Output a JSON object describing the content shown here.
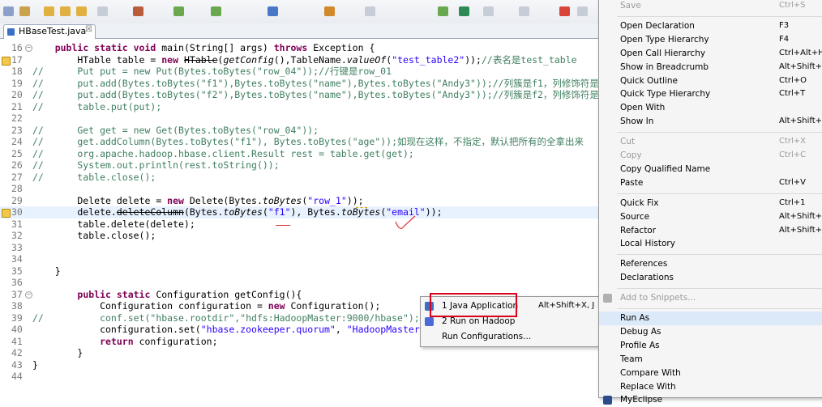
{
  "editor_tab": {
    "label": "HBaseTest.java",
    "close": "☒"
  },
  "code_lines": [
    {
      "n": "16",
      "html": "    <span class='kw'>public static void</span> main(String[] args) <span class='kw'>throws</span> Exception {"
    },
    {
      "n": "17",
      "html": "        HTable table = <span class='kw'>new</span> <span class='strike'>HTable</span>(<span class='ital'>getConfig</span>(),TableName.<span class='ital'>valueOf</span>(<span class='str'>\"test_table2\"</span>));<span class='com'>//表名是test_table</span>"
    },
    {
      "n": "18",
      "html": "<span class='com'>//      Put put = new Put(Bytes.toBytes(\"row_04\"));//行键是row_01</span>"
    },
    {
      "n": "19",
      "html": "<span class='com'>//      put.add(Bytes.toBytes(\"f1\"),Bytes.toBytes(\"name\"),Bytes.toBytes(\"Andy3\"));//列簇是f1，列修饰符是nam</span>"
    },
    {
      "n": "20",
      "html": "<span class='com'>//      put.add(Bytes.toBytes(\"f2\"),Bytes.toBytes(\"name\"),Bytes.toBytes(\"Andy3\"));//列簇是f2，列修饰符是nam</span>"
    },
    {
      "n": "21",
      "html": "<span class='com'>//      table.put(put);</span>"
    },
    {
      "n": "22",
      "html": ""
    },
    {
      "n": "23",
      "html": "<span class='com'>//      Get get = new Get(Bytes.toBytes(\"row_04\"));</span>"
    },
    {
      "n": "24",
      "html": "<span class='com'>//      get.addColumn(Bytes.toBytes(\"f1\"), Bytes.toBytes(\"age\"));如现在这样，不指定，默认把所有的全拿出来</span>"
    },
    {
      "n": "25",
      "html": "<span class='com'>//      org.apache.hadoop.hbase.client.Result rest = table.get(get);</span>"
    },
    {
      "n": "26",
      "html": "<span class='com'>//      System.out.println(rest.toString());</span>"
    },
    {
      "n": "27",
      "html": "<span class='com'>//      table.close();</span>"
    },
    {
      "n": "28",
      "html": ""
    },
    {
      "n": "29",
      "html": "        Delete delete = <span class='kw'>new</span> Delete(Bytes.<span class='ital'>toBytes</span>(<span class='str'>\"row_1\"</span>));"
    },
    {
      "n": "30",
      "html": "        delete.<span class='strike'>deleteColumn</span>(Bytes.<span class='ital'>toBytes</span>(<span class='str'>\"f1\"</span>), Bytes.<span class='ital'>toBytes</span>(<span class='str'>\"email\"</span>));"
    },
    {
      "n": "31",
      "html": "        table.delete(delete);"
    },
    {
      "n": "32",
      "html": "        table.close();"
    },
    {
      "n": "33",
      "html": ""
    },
    {
      "n": "34",
      "html": ""
    },
    {
      "n": "35",
      "html": "    }"
    },
    {
      "n": "36",
      "html": ""
    },
    {
      "n": "37",
      "html": "        <span class='kw'>public static</span> Configuration getConfig(){"
    },
    {
      "n": "38",
      "html": "            Configuration configuration = <span class='kw'>new</span> Configuration();"
    },
    {
      "n": "39",
      "html": "<span class='com'>//          conf.set(\"hbase.rootdir\",\"hdfs:HadoopMaster:9000/hbase\");</span>"
    },
    {
      "n": "40",
      "html": "            configuration.set(<span class='str'>\"hbase.zookeeper.quorum\"</span>, <span class='str'>\"HadoopMaster</span>"
    },
    {
      "n": "41",
      "html": "            <span class='kw'>return</span> configuration;"
    },
    {
      "n": "42",
      "html": "        }"
    },
    {
      "n": "43",
      "html": "}"
    },
    {
      "n": "44",
      "html": ""
    }
  ],
  "run_as_submenu": {
    "items": [
      {
        "label": "1 Java Application",
        "accel": "Alt+Shift+X, J",
        "icon_color": "#3a6fc7"
      },
      {
        "label": "2 Run on Hadoop",
        "accel": "",
        "icon_color": "#4a6bd8"
      },
      {
        "label": "Run Configurations...",
        "accel": "",
        "icon_color": ""
      }
    ]
  },
  "context_menu": {
    "items": [
      {
        "label": "Save",
        "accel": "Ctrl+S",
        "disabled": true
      },
      {
        "sep": true
      },
      {
        "label": "Open Declaration",
        "accel": "F3"
      },
      {
        "label": "Open Type Hierarchy",
        "accel": "F4"
      },
      {
        "label": "Open Call Hierarchy",
        "accel": "Ctrl+Alt+H"
      },
      {
        "label": "Show in Breadcrumb",
        "accel": "Alt+Shift+B"
      },
      {
        "label": "Quick Outline",
        "accel": "Ctrl+O"
      },
      {
        "label": "Quick Type Hierarchy",
        "accel": "Ctrl+T"
      },
      {
        "label": "Open With",
        "accel": ""
      },
      {
        "label": "Show In",
        "accel": "Alt+Shift+W"
      },
      {
        "sep": true
      },
      {
        "label": "Cut",
        "accel": "Ctrl+X",
        "disabled": true
      },
      {
        "label": "Copy",
        "accel": "Ctrl+C",
        "disabled": true
      },
      {
        "label": "Copy Qualified Name",
        "accel": ""
      },
      {
        "label": "Paste",
        "accel": "Ctrl+V"
      },
      {
        "sep": true
      },
      {
        "label": "Quick Fix",
        "accel": "Ctrl+1"
      },
      {
        "label": "Source",
        "accel": "Alt+Shift+S"
      },
      {
        "label": "Refactor",
        "accel": "Alt+Shift+T"
      },
      {
        "label": "Local History",
        "accel": ""
      },
      {
        "sep": true
      },
      {
        "label": "References",
        "accel": ""
      },
      {
        "label": "Declarations",
        "accel": ""
      },
      {
        "sep": true
      },
      {
        "label": "Add to Snippets...",
        "accel": "",
        "disabled": true
      },
      {
        "sep": true
      },
      {
        "label": "Run As",
        "accel": "",
        "highlight": true
      },
      {
        "label": "Debug As",
        "accel": ""
      },
      {
        "label": "Profile As",
        "accel": ""
      },
      {
        "label": "Team",
        "accel": ""
      },
      {
        "label": "Compare With",
        "accel": ""
      },
      {
        "label": "Replace With",
        "accel": ""
      },
      {
        "label": "MyEclipse",
        "accel": ""
      }
    ]
  },
  "colors": {
    "keyword": "#7f0055",
    "string": "#2a00ff",
    "comment": "#3f7f5f",
    "annotation_red": "#d9001b"
  }
}
